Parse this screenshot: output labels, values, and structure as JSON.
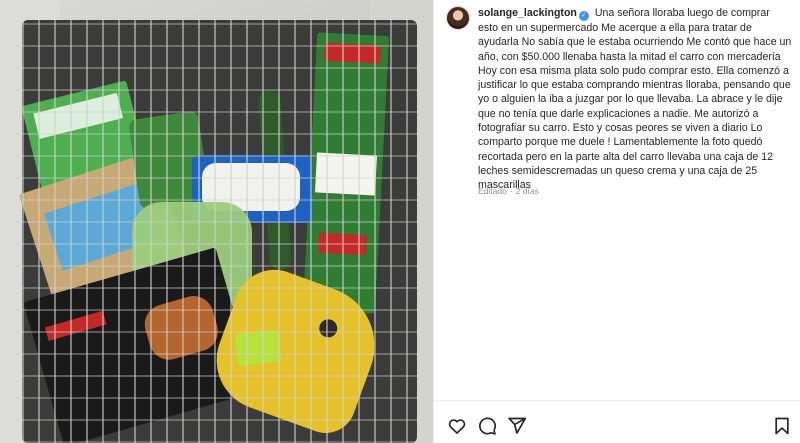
{
  "post": {
    "username": "solange_lackington",
    "verified_mark": "✓",
    "caption": "Una señora lloraba luego de comprar esto en un supermercado Me acerque a ella para tratar de ayudarla No sabía que le estaba ocurriendo Me contó que hace un año, con $50.000 llenaba hasta la mitad el carro con mercadería Hoy con esa misma plata solo pudo comprar esto. Ella comenzó a justificar lo que estaba comprando mientras lloraba, pensando que yo o alguien la iba a juzgar por lo que llevaba. La abrace y le dije que no tenía que darle explicaciones a nadie. Me autorizó a fotografiar su carro. Esto y cosas peores se viven a diario Lo comparto porque me duele ! Lamentablemente la foto quedó recortada pero en la parte alta del carro llevaba una caja de 12 leches semidescremadas un queso crema y una caja de 25 mascarillas",
    "edited_label": "Editado",
    "separator": "·",
    "time_ago": "2 días"
  },
  "actions": {
    "like": "heart-icon",
    "comment": "comment-icon",
    "share": "share-icon",
    "save": "bookmark-icon"
  },
  "colors": {
    "verified": "#3897f0",
    "text": "#262626",
    "muted": "#8e8e8e"
  }
}
